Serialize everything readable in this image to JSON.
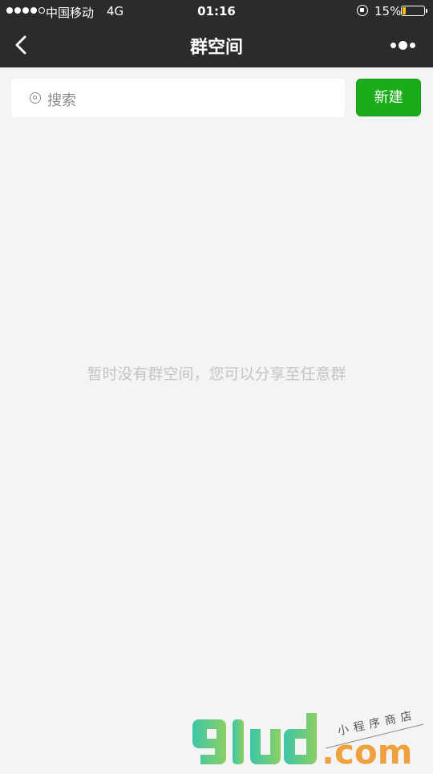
{
  "status_bar": {
    "signal_filled": 4,
    "signal_total": 5,
    "carrier": "中国移动",
    "network": "4G",
    "time": "01:16",
    "battery_percent_label": "15%",
    "battery_level": 0.15,
    "battery_color": "#f5c400",
    "icons": [
      "signal-dots-icon",
      "orientation-lock-icon",
      "battery-icon"
    ]
  },
  "nav": {
    "title": "群空间",
    "back_icon": "chevron-left-icon",
    "more_icon": "more-dots-icon"
  },
  "search": {
    "icon": "search-icon",
    "placeholder": "搜索"
  },
  "actions": {
    "new_label": "新建"
  },
  "empty_state": {
    "message": "暂时没有群空间，您可以分享至任意群"
  },
  "watermark": {
    "brand": "91ud",
    "domain": ".com",
    "tagline": "小程序商店"
  },
  "colors": {
    "header_bg": "#2b2b2b",
    "page_bg": "#f4f4f4",
    "accent_green": "#1aad19",
    "placeholder": "#8a8a8a",
    "empty_text": "#c4c4c4",
    "watermark_teal": "#3cc6a8",
    "watermark_green": "#8ccf63",
    "watermark_orange": "#f0a03c"
  }
}
